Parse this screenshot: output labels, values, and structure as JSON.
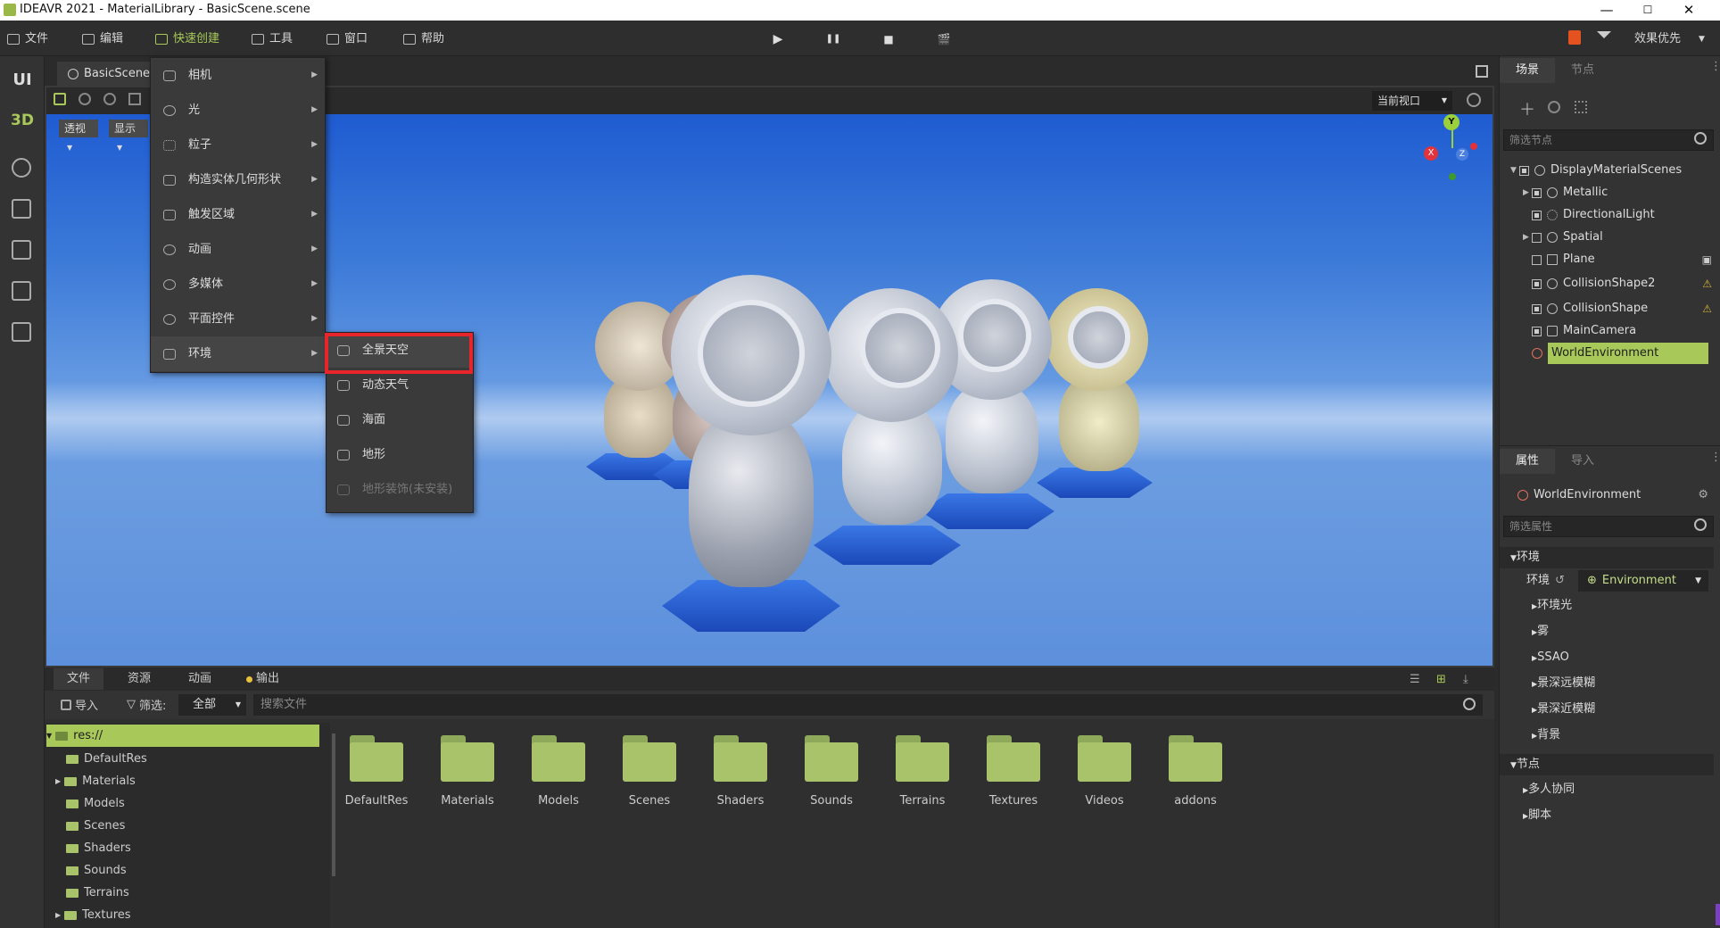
{
  "window": {
    "title": "IDEAVR 2021 - MaterialLibrary - BasicScene.scene",
    "min": "—",
    "max": "☐",
    "close": "✕"
  },
  "menubar": {
    "items": [
      {
        "label": "文件",
        "name": "menu-file"
      },
      {
        "label": "编辑",
        "name": "menu-edit"
      },
      {
        "label": "快速创建",
        "name": "menu-quick-create"
      },
      {
        "label": "工具",
        "name": "menu-tools"
      },
      {
        "label": "窗口",
        "name": "menu-window"
      },
      {
        "label": "帮助",
        "name": "menu-help"
      }
    ],
    "play": "▶",
    "pause": "❚❚",
    "stop": "■",
    "movie": "🎬",
    "quality": "效果优先"
  },
  "leftrail": {
    "ui": "UI",
    "threed": "3D"
  },
  "scene": {
    "tab_label": "BasicScene",
    "view_mode": "透视",
    "display": "显示",
    "current_view": "当前视口"
  },
  "gizmo": {
    "y": "Y",
    "x": "X",
    "z": "Z"
  },
  "quickmenu": {
    "items": [
      "相机",
      "光",
      "粒子",
      "构造实体几何形状",
      "触发区域",
      "动画",
      "多媒体",
      "平面控件",
      "环境"
    ]
  },
  "envmenu": {
    "items": [
      "全景天空",
      "动态天气",
      "海面",
      "地形",
      "地形装饰(未安装)"
    ]
  },
  "rightpanel": {
    "tabs": {
      "scene": "场景",
      "node": "节点"
    },
    "filter_nodes": "筛选节点",
    "tree": [
      {
        "label": "DisplayMaterialScenes"
      },
      {
        "label": "Metallic"
      },
      {
        "label": "DirectionalLight"
      },
      {
        "label": "Spatial"
      },
      {
        "label": "Plane"
      },
      {
        "label": "CollisionShape2"
      },
      {
        "label": "CollisionShape"
      },
      {
        "label": "MainCamera"
      },
      {
        "label": "WorldEnvironment"
      }
    ],
    "prop_tabs": {
      "props": "属性",
      "import": "导入"
    },
    "selected_node": "WorldEnvironment",
    "filter_props": "筛选属性",
    "env_section": "环境",
    "env_label": "环境",
    "env_value": "Environment",
    "env_props": [
      "环境光",
      "雾",
      "SSAO",
      "景深远模糊",
      "景深近模糊",
      "背景"
    ],
    "node_section": "节点",
    "node_props": [
      "多人协同",
      "脚本"
    ]
  },
  "bottompanel": {
    "tabs": {
      "files": "文件",
      "resources": "资源",
      "animation": "动画",
      "output": "输出"
    },
    "import": "导入",
    "filter": "筛选:",
    "filter_value": "全部",
    "search_placeholder": "搜索文件",
    "tree": [
      {
        "label": "res://"
      },
      {
        "label": "DefaultRes"
      },
      {
        "label": "Materials"
      },
      {
        "label": "Models"
      },
      {
        "label": "Scenes"
      },
      {
        "label": "Shaders"
      },
      {
        "label": "Sounds"
      },
      {
        "label": "Terrains"
      },
      {
        "label": "Textures"
      }
    ],
    "folders": [
      "DefaultRes",
      "Materials",
      "Models",
      "Scenes",
      "Shaders",
      "Sounds",
      "Terrains",
      "Textures",
      "Videos",
      "addons"
    ]
  },
  "colors": {
    "accent": "#a8c85a",
    "highlight": "#e8252a"
  }
}
